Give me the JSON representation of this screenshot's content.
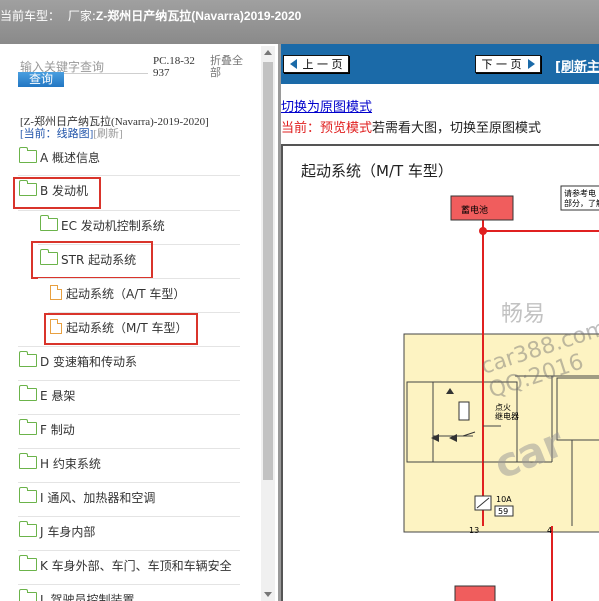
{
  "header": {
    "prefix": "当前车型：",
    "manufacturer_label": "厂家:",
    "model": "Z-郑州日产纳瓦拉(Navarra)2019-2020"
  },
  "sidebar": {
    "search_placeholder": "输入关键字查询",
    "query_button": "查询",
    "pc_code": "PC.18-32937",
    "fold_all": "折叠全部",
    "car_info": "[Z-郑州日产纳瓦拉(Navarra)-2019-2020]",
    "current_prefix": "[当前：线路图]",
    "refresh": "[刷新]",
    "tree": [
      {
        "label": "A 概述信息",
        "icon": "folder-icon"
      },
      {
        "label": "B 发动机",
        "icon": "folder-open-icon"
      },
      {
        "label": "EC 发动机控制系统",
        "icon": "folder-icon"
      },
      {
        "label": "STR 起动系统",
        "icon": "folder-open-icon"
      },
      {
        "label": "起动系统（A/T 车型）",
        "icon": "document-icon"
      },
      {
        "label": "起动系统（M/T 车型）",
        "icon": "document-icon"
      },
      {
        "label": "D 变速箱和传动系",
        "icon": "folder-icon"
      },
      {
        "label": "E 悬架",
        "icon": "folder-icon"
      },
      {
        "label": "F 制动",
        "icon": "folder-icon"
      },
      {
        "label": "H 约束系统",
        "icon": "folder-icon"
      },
      {
        "label": "I 通风、加热器和空调",
        "icon": "folder-icon"
      },
      {
        "label": "J 车身内部",
        "icon": "folder-icon"
      },
      {
        "label": "K 车身外部、车门、车顶和车辆安全",
        "icon": "folder-icon"
      },
      {
        "label": "L 驾驶员控制装置",
        "icon": "folder-icon"
      }
    ]
  },
  "content": {
    "prev_button": "上 一 页",
    "next_button": "下 一 页",
    "refresh_link": "[刷新主",
    "switch_link": "切换为原图模式",
    "mode_current": "当前：预览模式",
    "mode_hint": "若需看大图，切换至原图模式",
    "diagram": {
      "title": "起动系统（M/T 车型）",
      "battery_label": "蓄电池",
      "note_line1": "请参考电",
      "note_line2": "部分，了解",
      "relay_label_1": "点火",
      "relay_label_2": "继电器",
      "fuse_label_1": "10A",
      "fuse_label_2": "59",
      "pin_left": "13",
      "pin_right": "4",
      "watermark_cn": "畅易",
      "watermark_url": "car388.com",
      "watermark_qq": "QQ:2016",
      "watermark_logo": "car"
    },
    "colors": {
      "wire": "#e02020",
      "fuse_box": "#fdf3c2",
      "battery_fill": "#f05d5d",
      "nav_bar": "#1b6aa8"
    }
  }
}
